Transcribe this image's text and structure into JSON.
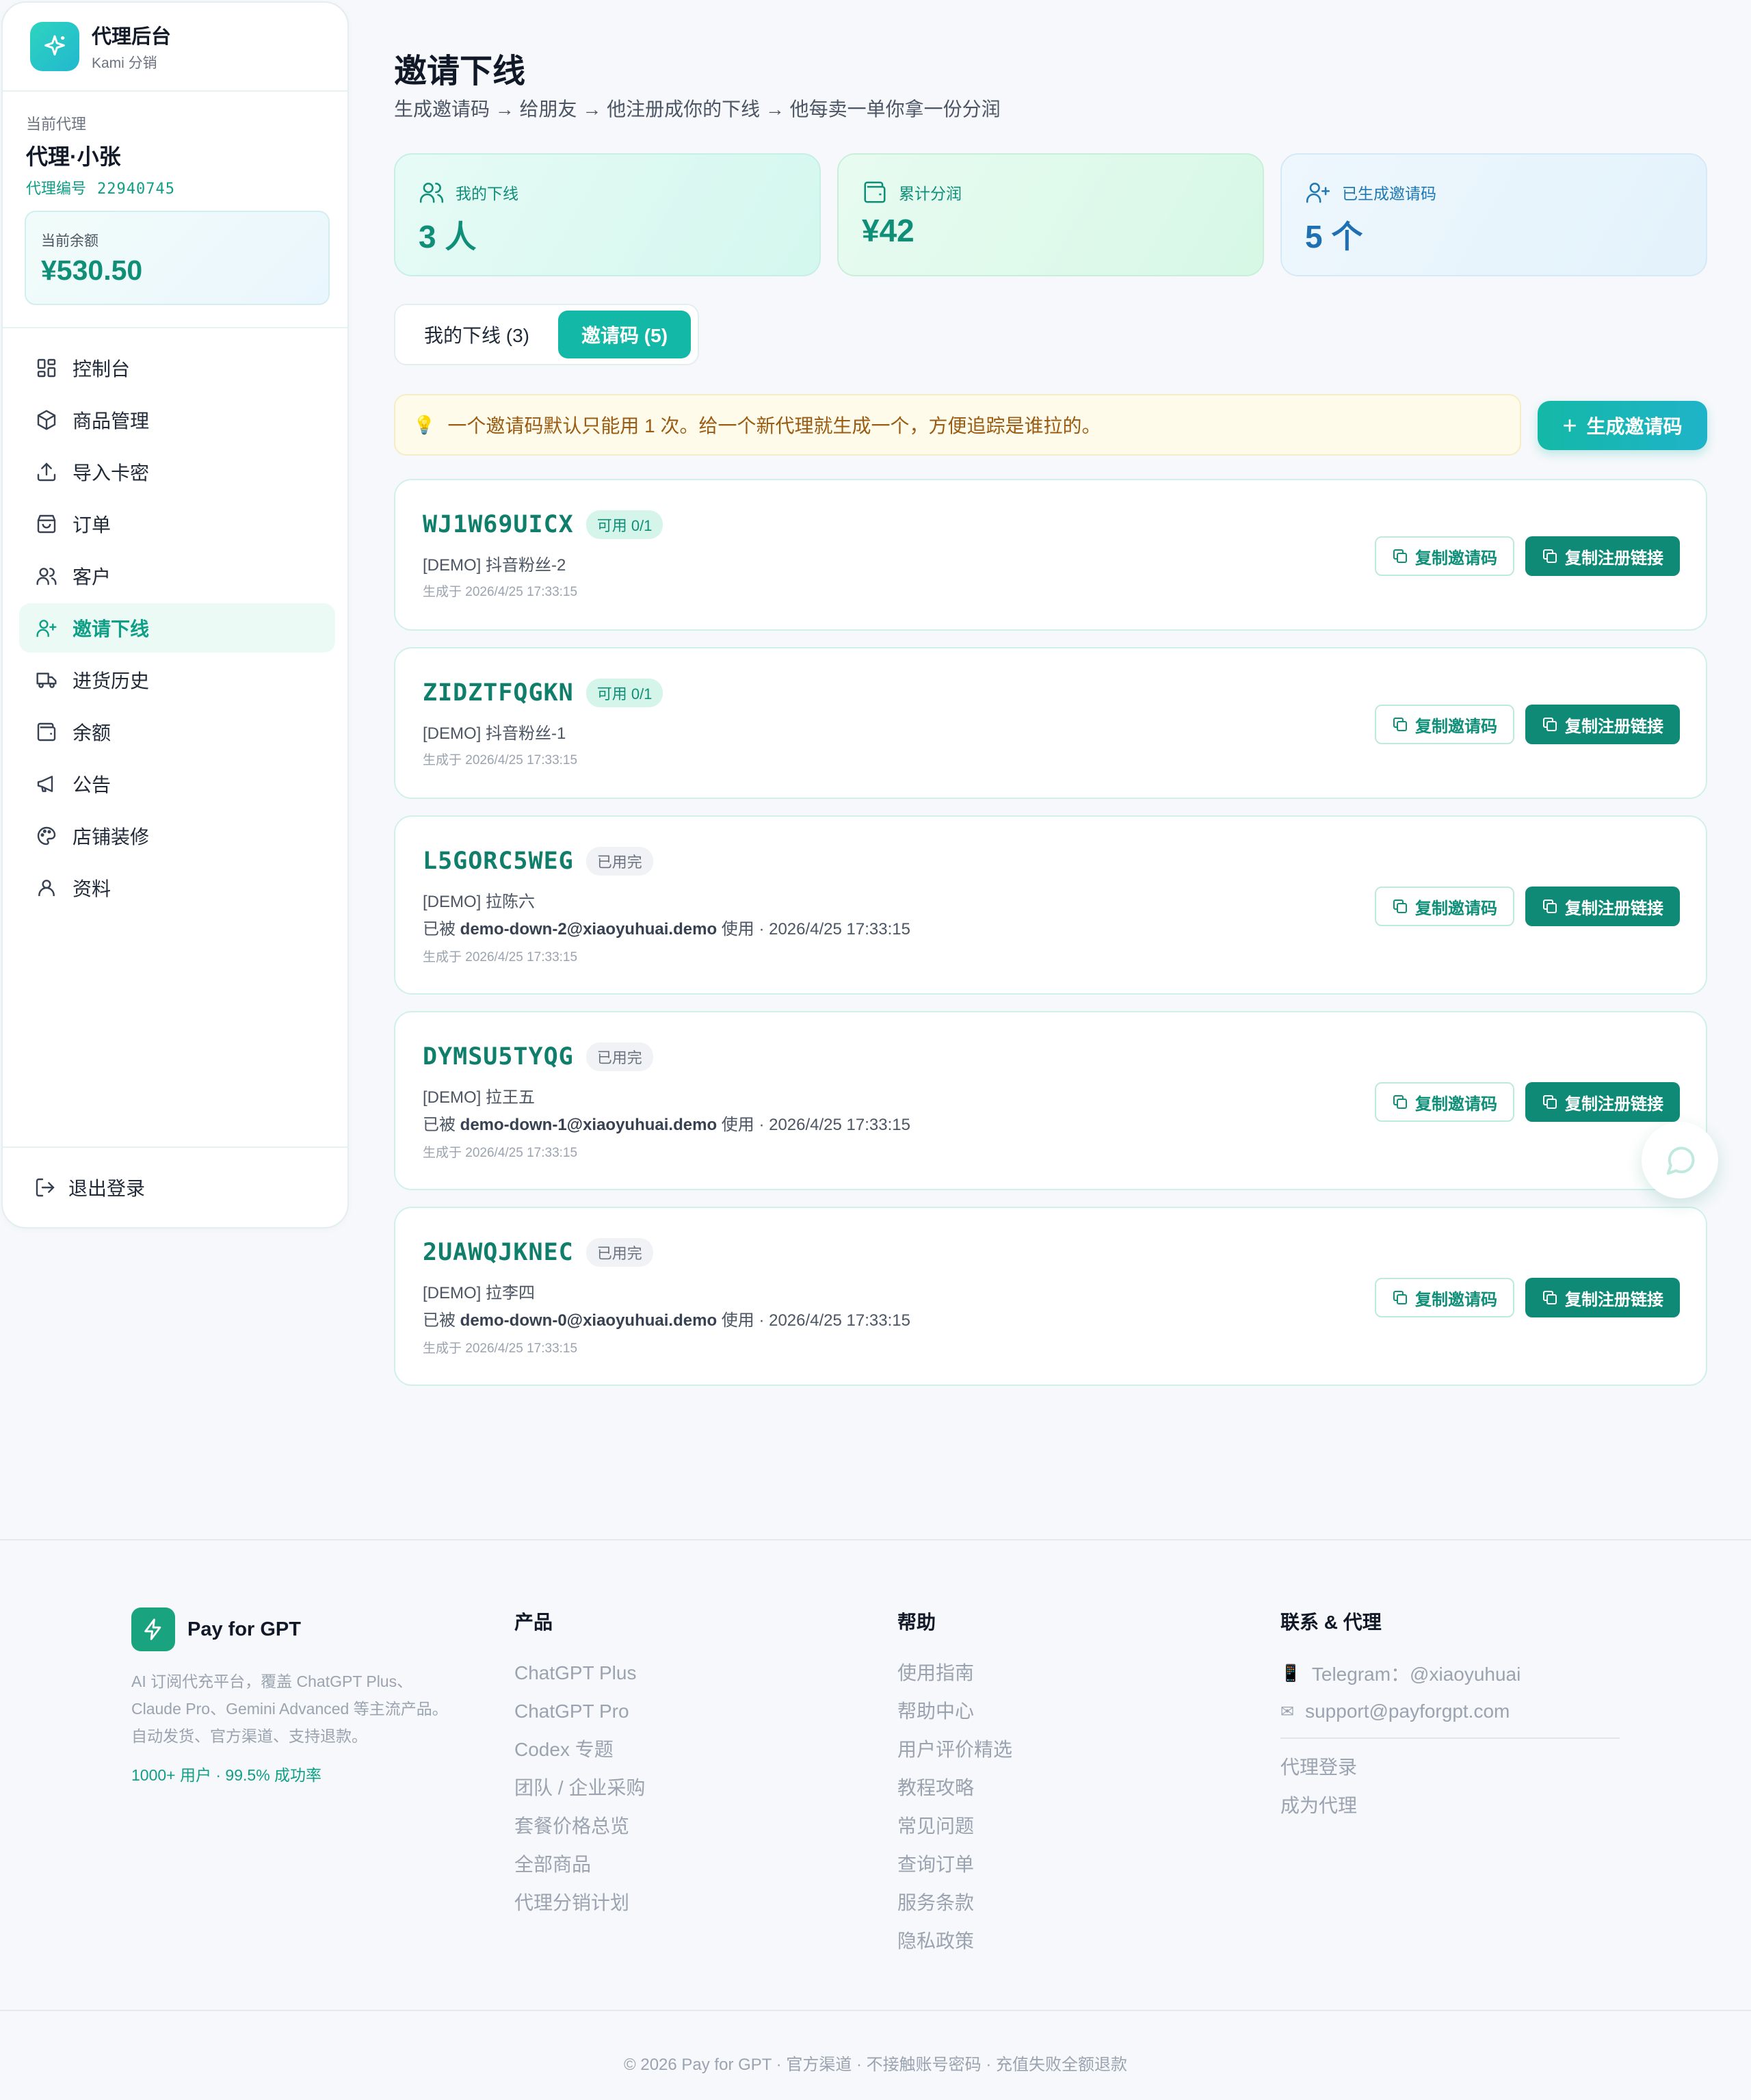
{
  "sidebar": {
    "brand_title": "代理后台",
    "brand_sub": "Kami 分销",
    "agent_label": "当前代理",
    "agent_name": "代理·小张",
    "agent_id_label": "代理编号",
    "agent_id": "22940745",
    "balance_label": "当前余额",
    "balance_value": "¥530.50",
    "items": [
      {
        "label": "控制台",
        "icon": "grid-icon"
      },
      {
        "label": "商品管理",
        "icon": "box-icon"
      },
      {
        "label": "导入卡密",
        "icon": "upload-icon"
      },
      {
        "label": "订单",
        "icon": "bag-icon"
      },
      {
        "label": "客户",
        "icon": "users-icon"
      },
      {
        "label": "邀请下线",
        "icon": "user-plus-icon",
        "active": true
      },
      {
        "label": "进货历史",
        "icon": "truck-icon"
      },
      {
        "label": "余额",
        "icon": "wallet-icon"
      },
      {
        "label": "公告",
        "icon": "megaphone-icon"
      },
      {
        "label": "店铺装修",
        "icon": "palette-icon"
      },
      {
        "label": "资料",
        "icon": "user-icon"
      }
    ],
    "logout": "退出登录"
  },
  "main": {
    "title": "邀请下线",
    "subtitle": "生成邀请码 → 给朋友 → 他注册成你的下线 → 他每卖一单你拿一份分润",
    "stats": [
      {
        "label": "我的下线",
        "value": "3 人"
      },
      {
        "label": "累计分润",
        "value": "¥42"
      },
      {
        "label": "已生成邀请码",
        "value": "5 个"
      }
    ],
    "tabs": [
      {
        "label": "我的下线 (3)"
      },
      {
        "label": "邀请码 (5)",
        "active": true
      }
    ],
    "tip": "一个邀请码默认只能用 1 次。给一个新代理就生成一个，方便追踪是谁拉的。",
    "generate_button": "生成邀请码",
    "copy_code_label": "复制邀请码",
    "copy_link_label": "复制注册链接",
    "codes": [
      {
        "code": "WJ1W69UICX",
        "status": "可用 0/1",
        "used": false,
        "note": "[DEMO] 抖音粉丝-2",
        "created": "生成于 2026/4/25 17:33:15"
      },
      {
        "code": "ZIDZTFQGKN",
        "status": "可用 0/1",
        "used": false,
        "note": "[DEMO] 抖音粉丝-1",
        "created": "生成于 2026/4/25 17:33:15"
      },
      {
        "code": "L5GORC5WEG",
        "status": "已用完",
        "used": true,
        "note": "[DEMO] 拉陈六",
        "used_prefix": "已被",
        "used_by": "demo-down-2@xiaoyuhuai.demo",
        "used_suffix": "使用 · 2026/4/25 17:33:15",
        "created": "生成于 2026/4/25 17:33:15"
      },
      {
        "code": "DYMSU5TYQG",
        "status": "已用完",
        "used": true,
        "note": "[DEMO] 拉王五",
        "used_prefix": "已被",
        "used_by": "demo-down-1@xiaoyuhuai.demo",
        "used_suffix": "使用 · 2026/4/25 17:33:15",
        "created": "生成于 2026/4/25 17:33:15"
      },
      {
        "code": "2UAWQJKNEC",
        "status": "已用完",
        "used": true,
        "note": "[DEMO] 拉李四",
        "used_prefix": "已被",
        "used_by": "demo-down-0@xiaoyuhuai.demo",
        "used_suffix": "使用 · 2026/4/25 17:33:15",
        "created": "生成于 2026/4/25 17:33:15"
      }
    ]
  },
  "footer": {
    "brand": "Pay for GPT",
    "desc_lines": [
      "AI 订阅代充平台，覆盖 ChatGPT Plus、",
      "Claude Pro、Gemini Advanced 等主流产品。",
      "自动发货、官方渠道、支持退款。"
    ],
    "stat": "1000+ 用户 · 99.5% 成功率",
    "products_title": "产品",
    "products": [
      "ChatGPT Plus",
      "ChatGPT Pro",
      "Codex 专题",
      "团队 / 企业采购",
      "套餐价格总览",
      "全部商品",
      "代理分销计划"
    ],
    "help_title": "帮助",
    "help": [
      "使用指南",
      "帮助中心",
      "用户评价精选",
      "教程攻略",
      "常见问题",
      "查询订单",
      "服务条款",
      "隐私政策"
    ],
    "contact_title": "联系 & 代理",
    "telegram": "Telegram：@xiaoyuhuai",
    "email": "support@payforgpt.com",
    "agent_links": [
      "代理登录",
      "成为代理"
    ],
    "copyright": "© 2026 Pay for GPT · 官方渠道 · 不接触账号密码 · 充值失败全额退款"
  }
}
